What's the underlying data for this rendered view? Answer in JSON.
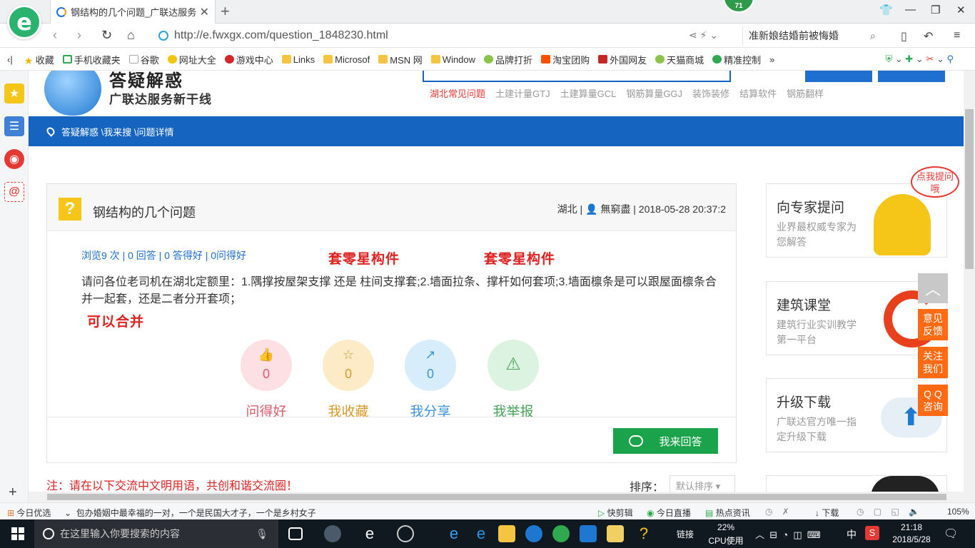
{
  "browser": {
    "tab_title": "钢结构的几个问题_广联达服务新",
    "tab_close": "✕",
    "new_tab": "+",
    "badge_count": "71",
    "url": "http://e.fwxgx.com/question_1848230.html",
    "search_value": "准新娘结婚前被悔婚",
    "bookmarks": [
      "收藏",
      "手机收藏夹",
      "谷歌",
      "网址大全",
      "游戏中心",
      "Links",
      "Microsof",
      "MSN 网",
      "Window",
      "品牌打折",
      "淘宝团购",
      "外国网友",
      "天猫商城",
      "精准控制"
    ],
    "bookmarks_more": "»"
  },
  "site": {
    "logo_title": "答疑解惑",
    "logo_sub": "广联达服务新干线",
    "hot_links": [
      "湖北常见问题",
      "土建计量GTJ",
      "土建算量GCL",
      "钢筋算量GGJ",
      "装饰装修",
      "结算软件",
      "钢筋翻样"
    ],
    "breadcrumb": "答疑解惑 \\我来搜 \\问题详情"
  },
  "question": {
    "mark": "?",
    "title": "钢结构的几个问题",
    "meta": "湖北 | 👤 無窮盡 | 2018-05-28 20:37:2",
    "stats": "浏览9 次 | 0 回答 | 0 答得好 | 0问得好",
    "body": "请问各位老司机在湖北定额里：1.隅撑按屋架支撑 还是 柱间支撑套;2.墙面拉条、撑杆如何套项;3.墙面檩条是可以跟屋面檩条合并一起套，还是二者分开套项；",
    "annotations": [
      "套零星构件",
      "套零星构件",
      "可以合并"
    ],
    "actions": [
      {
        "label": "问得好",
        "count": "0",
        "icon": "👍",
        "color": "#e05a6a",
        "bg": "#fde0e4"
      },
      {
        "label": "我收藏",
        "count": "0",
        "icon": "☆",
        "color": "#d99a2b",
        "bg": "#fdebc8"
      },
      {
        "label": "我分享",
        "count": "0",
        "icon": "↗",
        "color": "#3f93d8",
        "bg": "#d8edfb"
      },
      {
        "label": "我举报",
        "count": "",
        "icon": "⚠",
        "color": "#48a35a",
        "bg": "#ddf3e2"
      }
    ],
    "answer_button": "我来回答"
  },
  "comments": {
    "notice": "注：请在以下交流中文明用语，共创和谐交流圈！",
    "sort_label": "排序：",
    "sort_value": "默认排序"
  },
  "sidebar": {
    "cards": [
      {
        "title": "向专家提问",
        "sub": "业界最权威专家为您解答"
      },
      {
        "title": "建筑课堂",
        "sub": "建筑行业实训教学第一平台"
      },
      {
        "title": "升级下载",
        "sub": "广联达官方唯一指定升级下载"
      }
    ],
    "mascot_bubble": "点我提问哦"
  },
  "float": {
    "top": "︿",
    "feedback": "意见反馈",
    "follow": "关注我们",
    "qq": "Q Q咨询"
  },
  "statusbar": {
    "left": "今日优选",
    "news": "包办婚姻中最幸福的一对，一个是民国大才子，一个是乡村女子",
    "tools": [
      "快剪辑",
      "今日直播",
      "热点资讯",
      "下载"
    ],
    "zoom": "105%"
  },
  "taskbar": {
    "search_placeholder": "在这里输入你要搜索的内容",
    "link": "链接",
    "cpu_value": "22%",
    "cpu_label": "CPU使用",
    "ime": "中",
    "time": "21:18",
    "date": "2018/5/28"
  }
}
